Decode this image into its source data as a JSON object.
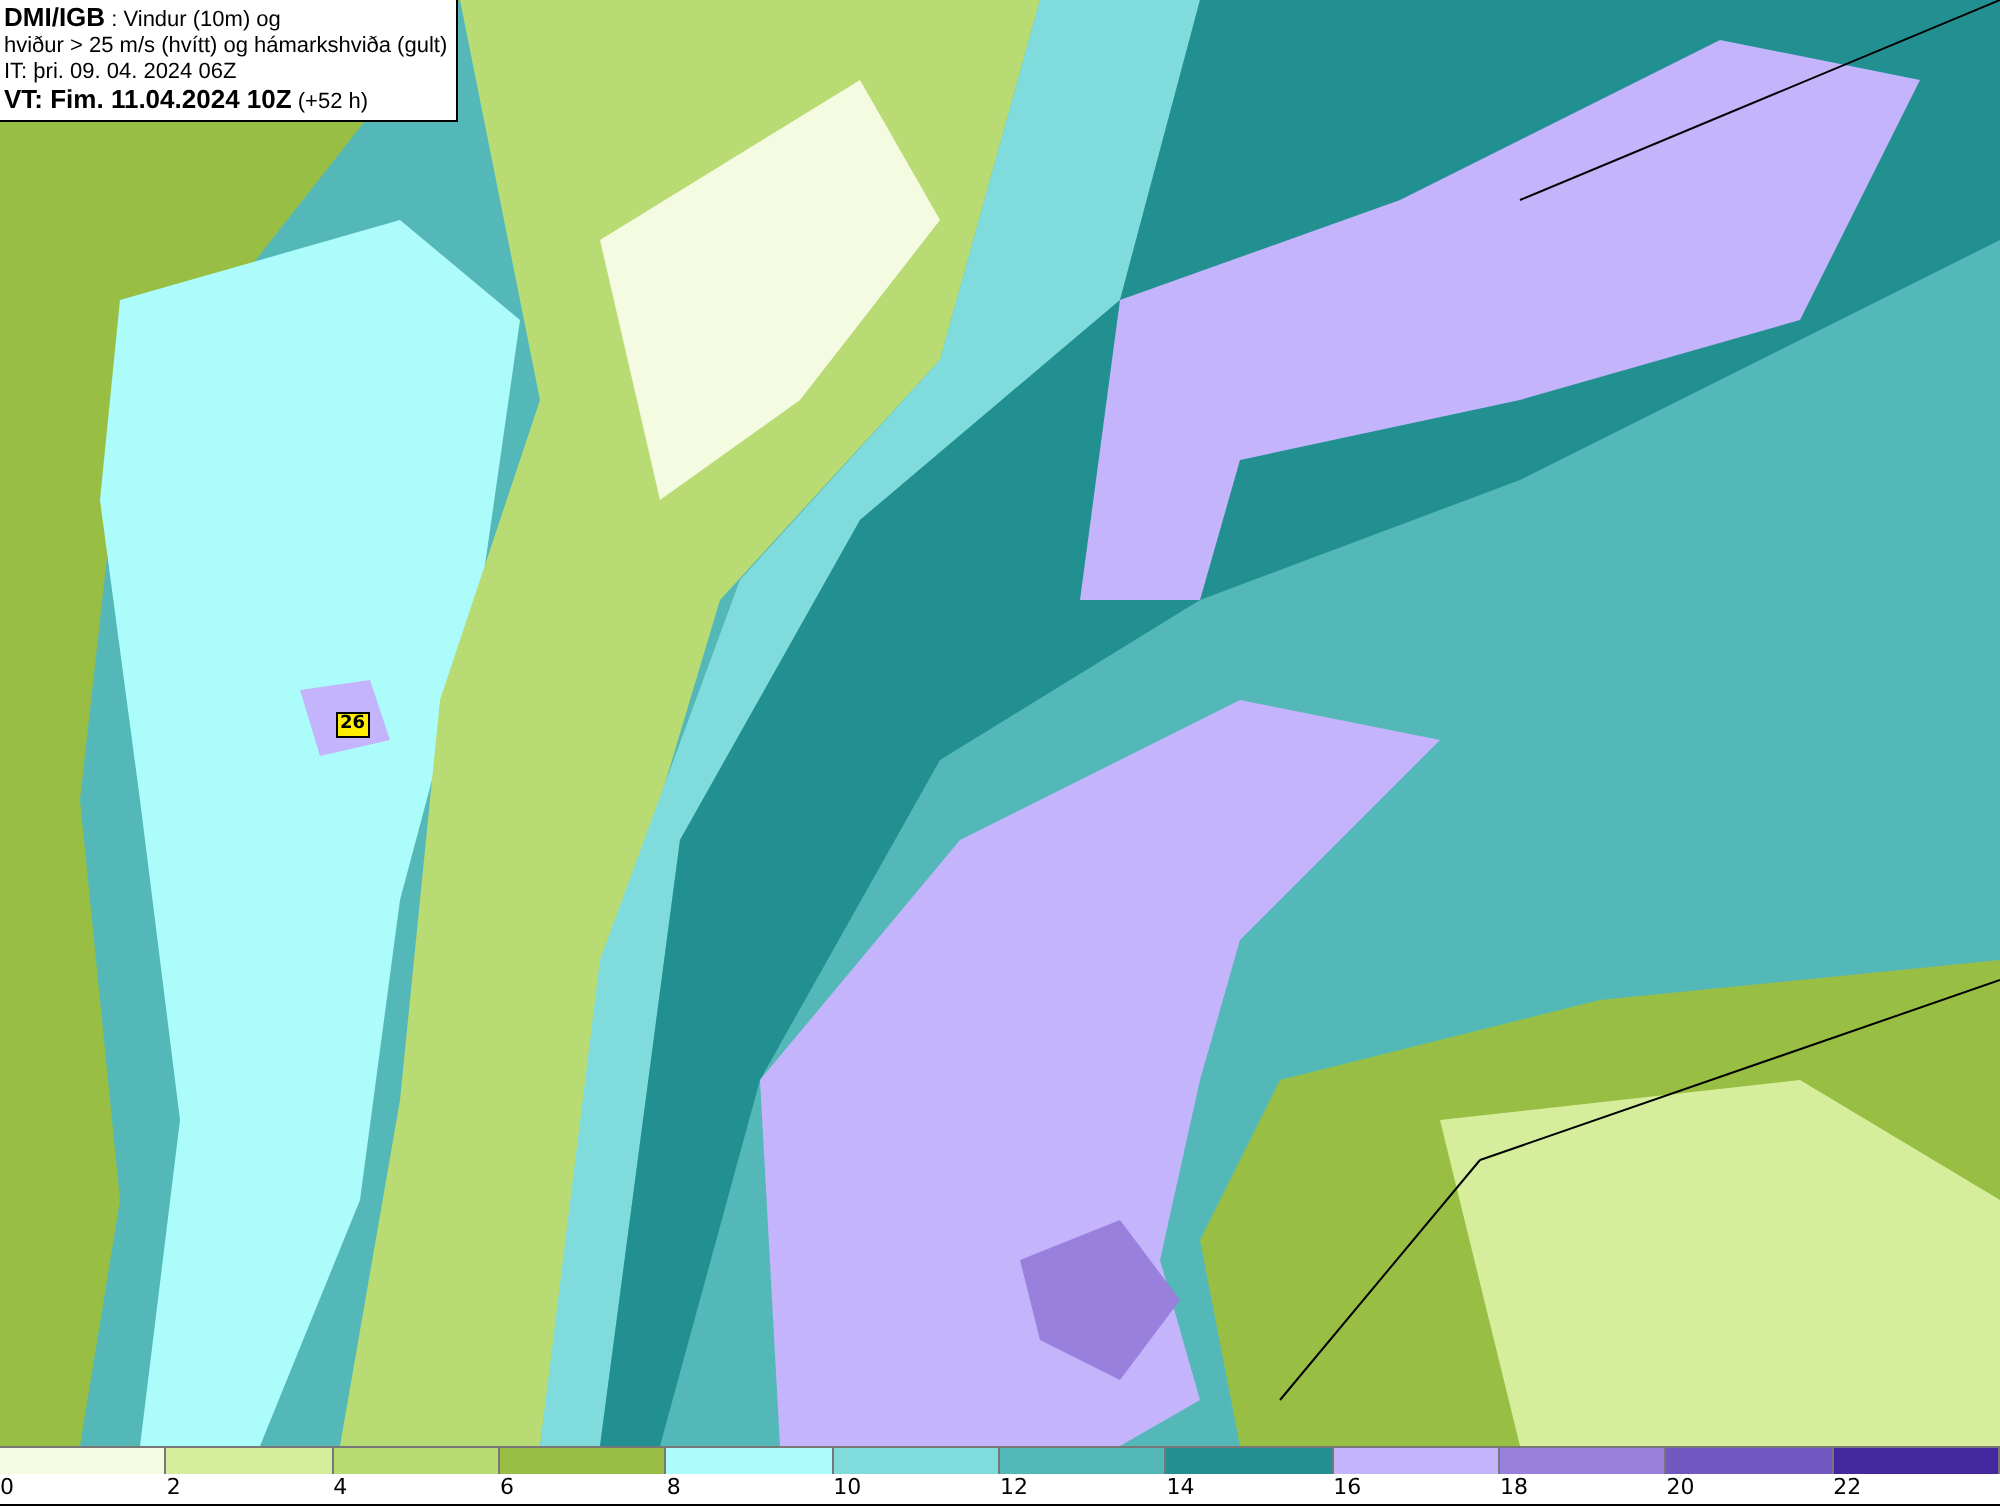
{
  "title_box": {
    "source": "DMI/IGB",
    "line_1": " : Vindur (10m) og",
    "line_2": "hviður > 25 m/s (hvítt) og hámarkshviða (gult)",
    "issue_time": "IT: þri. 09. 04. 2024 06Z",
    "valid_time": "VT: Fim. 11.04.2024 10Z",
    "lead": " (+52 h)"
  },
  "map": {
    "gust_badge": "26"
  },
  "legend": [
    {
      "label": "0",
      "color": "#f5fbe0"
    },
    {
      "label": "2",
      "color": "#d6ee9c"
    },
    {
      "label": "4",
      "color": "#b8db74"
    },
    {
      "label": "6",
      "color": "#98bf44"
    },
    {
      "label": "8",
      "color": "#adfcfc"
    },
    {
      "label": "10",
      "color": "#80dcdc"
    },
    {
      "label": "12",
      "color": "#55b8b8"
    },
    {
      "label": "14",
      "color": "#229090"
    },
    {
      "label": "16",
      "color": "#c4b4fc"
    },
    {
      "label": "18",
      "color": "#9880dc"
    },
    {
      "label": "20",
      "color": "#7058c0"
    },
    {
      "label": "22",
      "color": "#4428a0"
    }
  ]
}
